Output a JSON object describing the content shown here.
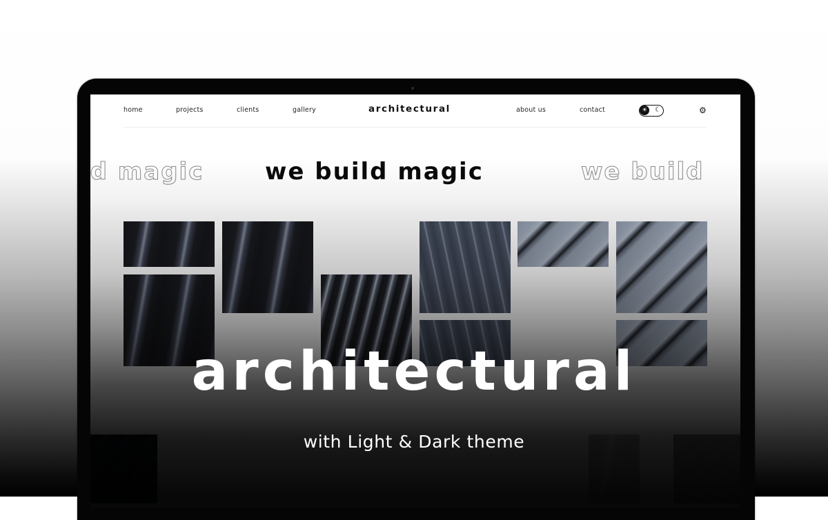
{
  "nav": {
    "left_links": [
      {
        "label": "home"
      },
      {
        "label": "projects"
      },
      {
        "label": "clients"
      },
      {
        "label": "gallery"
      }
    ],
    "brand": "architectural",
    "right_links": [
      {
        "label": "about us"
      },
      {
        "label": "contact"
      }
    ],
    "theme_toggle": {
      "state": "light",
      "light_icon": "☀",
      "dark_icon": "☾"
    },
    "settings_icon": "⚙"
  },
  "marquee": {
    "left_outline": "ld magic",
    "center": "we build magic",
    "right_outline": "we build"
  },
  "gallery": {
    "tiles": [
      {
        "name": "tile-dark-1",
        "style": "dark-stripes"
      },
      {
        "name": "tile-dark-2",
        "style": "dark-stripes"
      },
      {
        "name": "tile-dark-3",
        "style": "dark-stripes"
      },
      {
        "name": "tile-dark-4",
        "style": "dark-stripes-tight"
      },
      {
        "name": "tile-curve-1",
        "style": "curve-stripes"
      },
      {
        "name": "tile-curve-2",
        "style": "curve-stripes"
      },
      {
        "name": "tile-diag-1",
        "style": "diag-stripes"
      },
      {
        "name": "tile-diag-2",
        "style": "diag-stripes"
      },
      {
        "name": "tile-diag-3",
        "style": "diag-stripes"
      },
      {
        "name": "tile-navy-1",
        "style": "navy-stripes"
      },
      {
        "name": "tile-dark-5",
        "style": "dark-stripes"
      },
      {
        "name": "tile-navy-2",
        "style": "navy-stripes"
      }
    ]
  },
  "promo": {
    "headline": "architectural",
    "subline": "with Light & Dark theme"
  },
  "colors": {
    "text_dark": "#111111",
    "outline_text": "#8a8a8a",
    "headline_text": "#ffffff"
  }
}
